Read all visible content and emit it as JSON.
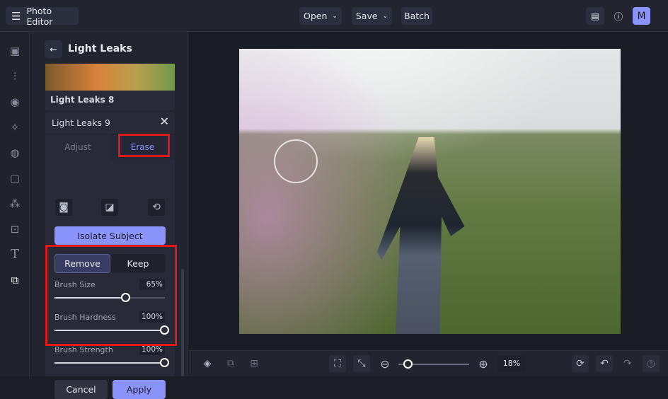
{
  "topbar": {
    "app_title": "Photo Editor",
    "open": "Open",
    "save": "Save",
    "batch": "Batch",
    "avatar": "M"
  },
  "panel": {
    "title": "Light Leaks",
    "prev_item": "Light Leaks 8",
    "card_title": "Light Leaks 9",
    "tabs": [
      {
        "label": "Adjust"
      },
      {
        "label": "Erase"
      }
    ],
    "isolate": "Isolate Subject",
    "remove": "Remove",
    "keep": "Keep",
    "sliders": [
      {
        "label": "Brush Size",
        "value": 65,
        "display": "65%"
      },
      {
        "label": "Brush Hardness",
        "value": 100,
        "display": "100%"
      },
      {
        "label": "Brush Strength",
        "value": 100,
        "display": "100%"
      }
    ],
    "cancel": "Cancel",
    "apply": "Apply"
  },
  "bottom": {
    "zoom": "18%",
    "zoom_value": 18
  },
  "colors": {
    "accent": "#8a93f9",
    "highlight": "#e01818"
  }
}
